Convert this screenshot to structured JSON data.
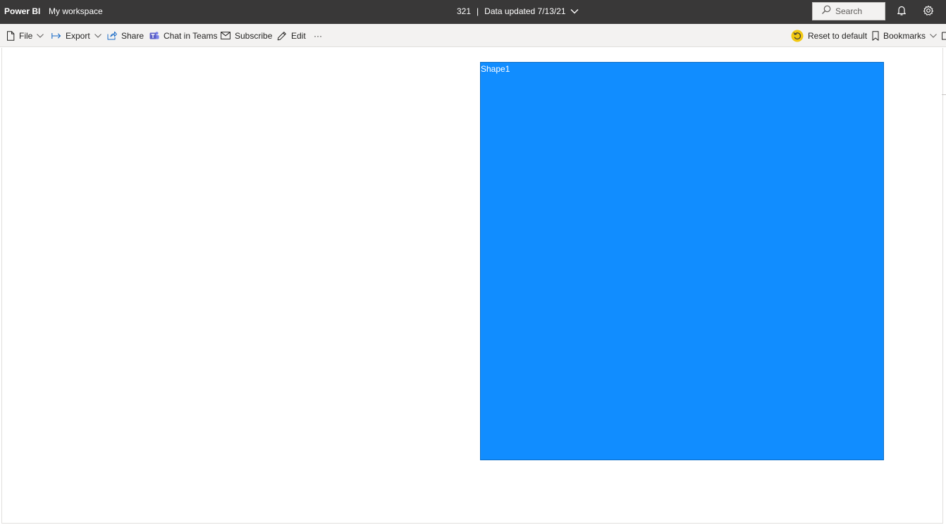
{
  "header": {
    "brand": "Power BI",
    "workspace": "My workspace",
    "report_name": "321",
    "separator": "|",
    "data_updated": "Data updated 7/13/21",
    "search_placeholder": "Search"
  },
  "actions": {
    "file": "File",
    "export": "Export",
    "share": "Share",
    "chat_in_teams": "Chat in Teams",
    "subscribe": "Subscribe",
    "edit": "Edit",
    "more": "···",
    "reset_to_default": "Reset to default",
    "bookmarks": "Bookmarks"
  },
  "canvas": {
    "shape_title": "Shape1",
    "shape_fill": "#118dff"
  },
  "colors": {
    "header_bg": "#393838",
    "actionbar_bg": "#f3f2f1",
    "teams_purple": "#5b5fc7",
    "reset_highlight": "#f2c811"
  },
  "icons": {
    "file": "file-icon",
    "export": "export-icon",
    "share": "share-icon",
    "teams": "teams-icon",
    "subscribe": "mail-icon",
    "edit": "pencil-icon",
    "reset": "reset-icon",
    "bookmark": "bookmark-icon",
    "search": "search-icon",
    "bell": "bell-icon",
    "gear": "gear-icon"
  }
}
